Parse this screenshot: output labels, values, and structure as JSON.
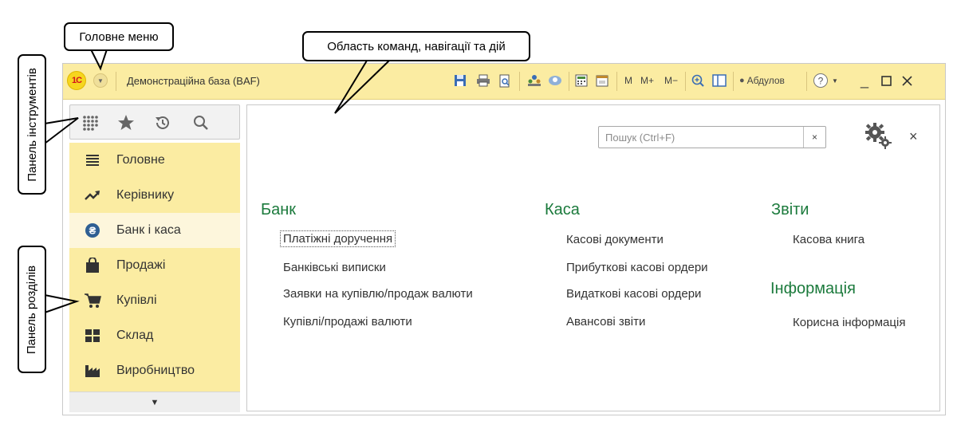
{
  "window": {
    "logo_text": "1С",
    "title": "Демонстраційна база (BAF)",
    "toolbar": {
      "m_label": "M",
      "mplus_label": "M+",
      "mminus_label": "M−",
      "user_name": "Абдулов"
    }
  },
  "tools_panel": {
    "items": [
      {
        "icon": "grid-menu-icon"
      },
      {
        "icon": "star-icon"
      },
      {
        "icon": "history-icon"
      },
      {
        "icon": "search-icon"
      }
    ]
  },
  "sections": [
    {
      "label": "Головне",
      "icon": "list-icon",
      "active": false
    },
    {
      "label": "Керівнику",
      "icon": "trend-icon",
      "active": false
    },
    {
      "label": "Банк і каса",
      "icon": "currency-icon",
      "active": true
    },
    {
      "label": "Продажі",
      "icon": "shopping-bag-icon",
      "active": false
    },
    {
      "label": "Купівлі",
      "icon": "cart-icon",
      "active": false
    },
    {
      "label": "Склад",
      "icon": "warehouse-icon",
      "active": false
    },
    {
      "label": "Виробництво",
      "icon": "factory-icon",
      "active": false
    }
  ],
  "search": {
    "placeholder": "Пошук (Ctrl+F)",
    "clear_label": "×"
  },
  "close_label": "×",
  "groups": {
    "bank": {
      "title": "Банк",
      "commands": [
        "Платіжні доручення",
        "Банківські виписки",
        "Заявки на купівлю/продаж валюти",
        "Купівлі/продажі валюти"
      ]
    },
    "kasa": {
      "title": "Каса",
      "commands": [
        "Касові документи",
        "Прибуткові касові ордери",
        "Видаткові касові ордери",
        "Авансові звіти"
      ]
    },
    "reports": {
      "title": "Звіти",
      "commands": [
        "Касова книга"
      ]
    },
    "info": {
      "title": "Інформація",
      "commands": [
        "Корисна інформація"
      ]
    }
  },
  "callouts": {
    "main_menu": "Головне меню",
    "commands_area": "Область команд, навігації та дій",
    "tools_panel": "Панель інструментів",
    "sections_panel": "Панель розділів"
  },
  "colors": {
    "titlebar": "#fbeca2",
    "sections_bg": "#fbeca2",
    "active_section": "#fdf6dc",
    "group_title": "#1b7a3c"
  }
}
